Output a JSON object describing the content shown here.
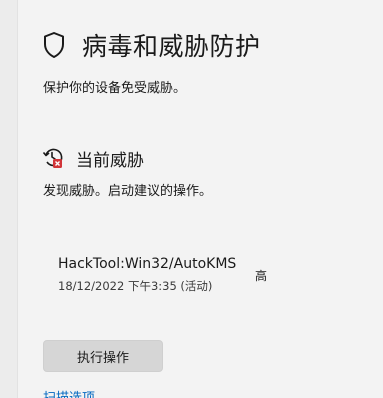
{
  "page": {
    "title": "病毒和威胁防护",
    "subtitle": "保护你的设备免受威胁。",
    "header_icon": "shield-icon"
  },
  "current_threats": {
    "title": "当前威胁",
    "icon": "threat-history-icon",
    "description": "发现威胁。启动建议的操作。",
    "items": [
      {
        "name": "HackTool:Win32/AutoKMS",
        "timestamp": "18/12/2022 下午3:35 (活动)",
        "severity": "高"
      }
    ],
    "action_button": "执行操作",
    "partial_link": "扫描选项"
  },
  "colors": {
    "background": "#f3f3f3",
    "button": "#d6d6d6",
    "link": "#0067c0",
    "alert_red": "#d13438"
  }
}
